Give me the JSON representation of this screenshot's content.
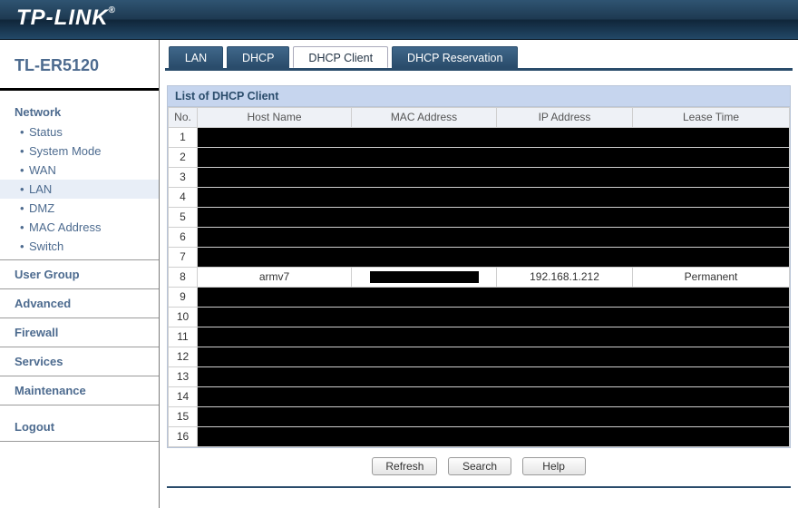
{
  "brand": "TP-LINK",
  "brand_mark": "®",
  "model": "TL-ER5120",
  "colors": {
    "accent": "#2a4c6b",
    "sidebar_link": "#4d6b8f",
    "panel_header_bg": "#c6d5ee"
  },
  "sidebar": {
    "sections": [
      {
        "label": "Network",
        "expanded": true,
        "items": [
          {
            "label": "Status"
          },
          {
            "label": "System Mode"
          },
          {
            "label": "WAN"
          },
          {
            "label": "LAN",
            "active": true
          },
          {
            "label": "DMZ"
          },
          {
            "label": "MAC Address"
          },
          {
            "label": "Switch"
          }
        ]
      },
      {
        "label": "User Group"
      },
      {
        "label": "Advanced"
      },
      {
        "label": "Firewall"
      },
      {
        "label": "Services"
      },
      {
        "label": "Maintenance"
      }
    ],
    "logout": "Logout"
  },
  "tabs": [
    {
      "label": "LAN"
    },
    {
      "label": "DHCP"
    },
    {
      "label": "DHCP Client",
      "active": true
    },
    {
      "label": "DHCP Reservation"
    }
  ],
  "panel": {
    "title": "List of DHCP Client",
    "columns": {
      "no": "No.",
      "host": "Host Name",
      "mac": "MAC Address",
      "ip": "IP Address",
      "lease": "Lease Time"
    },
    "rows": [
      {
        "no": 1,
        "redacted": true
      },
      {
        "no": 2,
        "redacted": true
      },
      {
        "no": 3,
        "redacted": true
      },
      {
        "no": 4,
        "redacted": true
      },
      {
        "no": 5,
        "redacted": true
      },
      {
        "no": 6,
        "redacted": true
      },
      {
        "no": 7,
        "redacted": true
      },
      {
        "no": 8,
        "host": "armv7",
        "mac": "[redacted]",
        "ip": "192.168.1.212",
        "lease": "Permanent"
      },
      {
        "no": 9,
        "redacted": true
      },
      {
        "no": 10,
        "redacted": true
      },
      {
        "no": 11,
        "redacted": true
      },
      {
        "no": 12,
        "redacted": true
      },
      {
        "no": 13,
        "redacted": true
      },
      {
        "no": 14,
        "redacted": true
      },
      {
        "no": 15,
        "redacted": true
      },
      {
        "no": 16,
        "redacted": true
      }
    ]
  },
  "buttons": {
    "refresh": "Refresh",
    "search": "Search",
    "help": "Help"
  }
}
